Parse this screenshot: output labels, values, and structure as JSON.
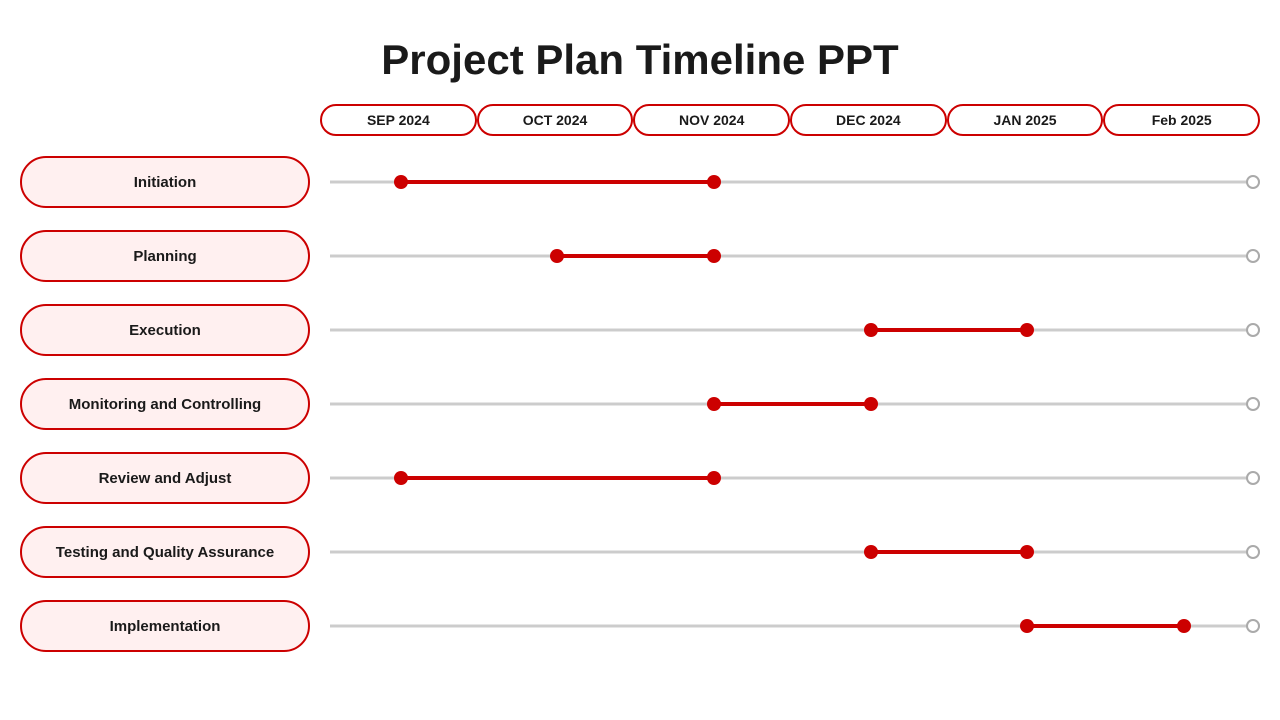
{
  "title": "Project Plan Timeline PPT",
  "months": [
    {
      "label": "SEP 2024"
    },
    {
      "label": "OCT 2024"
    },
    {
      "label": "NOV 2024"
    },
    {
      "label": "DEC 2024"
    },
    {
      "label": "JAN 2025"
    },
    {
      "label": "Feb 2025"
    }
  ],
  "rows": [
    {
      "label": "Initiation",
      "start": 0.45,
      "end": 2.45
    },
    {
      "label": "Planning",
      "start": 1.45,
      "end": 2.45
    },
    {
      "label": "Execution",
      "start": 3.45,
      "end": 4.45
    },
    {
      "label": "Monitoring and Controlling",
      "start": 2.45,
      "end": 3.45
    },
    {
      "label": "Review and Adjust",
      "start": 0.45,
      "end": 2.45
    },
    {
      "label": "Testing and Quality Assurance",
      "start": 3.45,
      "end": 4.45
    },
    {
      "label": "Implementation",
      "start": 4.45,
      "end": 5.45
    }
  ],
  "colors": {
    "accent": "#cc0000",
    "label_bg": "#fff0f0",
    "label_border": "#cc0000",
    "track_line": "#cccccc"
  }
}
